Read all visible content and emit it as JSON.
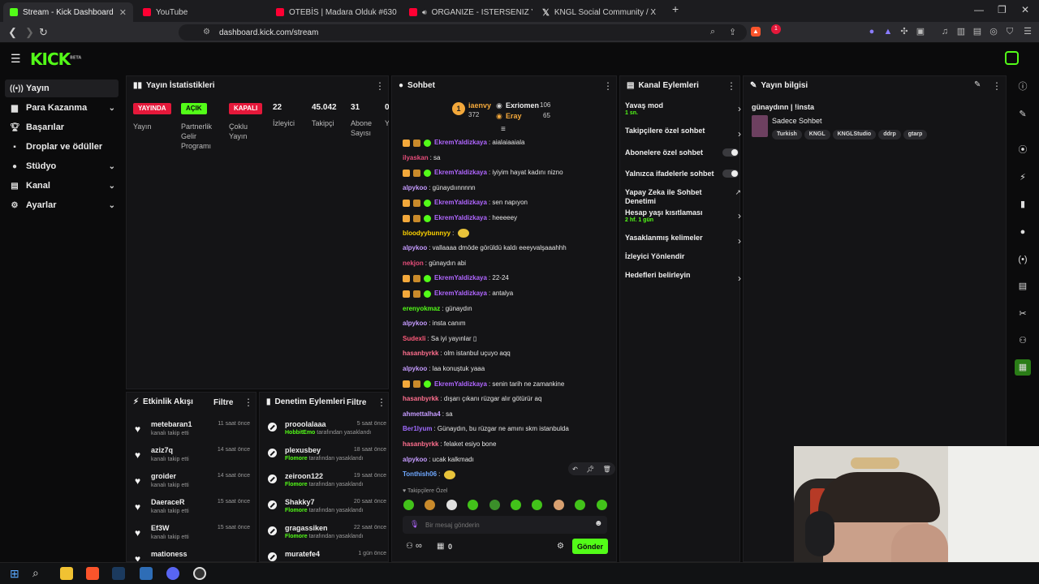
{
  "browser": {
    "tabs": [
      {
        "title": "Stream - Kick Dashboard",
        "fav": "#53fc18"
      },
      {
        "title": "YouTube",
        "fav": "#ff0033"
      },
      {
        "title": "OTEBİS | Madara Olduk #630 - YouTu",
        "fav": "#ff0033"
      },
      {
        "title": "ORGANIZE - ISTERSENIZ YANLIŞ",
        "fav": "#ff0033"
      },
      {
        "title": "KNGL Social Community / X",
        "fav": "#ffffff"
      }
    ],
    "url": "dashboard.kick.com/stream",
    "new_tab": "+",
    "ext_badge": "1"
  },
  "kick": {
    "logo": "KICK",
    "logo_sup": "BETA"
  },
  "sidebar": {
    "items": [
      {
        "label": "Yayın",
        "icon": "broadcast-icon"
      },
      {
        "label": "Para Kazanma",
        "icon": "money-icon",
        "chev": "⌄"
      },
      {
        "label": "Başarılar",
        "icon": "trophy-icon"
      },
      {
        "label": "Droplar ve ödüller",
        "icon": "gift-icon"
      },
      {
        "label": "Stüdyo",
        "icon": "studio-icon",
        "chev": "⌄"
      },
      {
        "label": "Kanal",
        "icon": "channel-icon",
        "chev": "⌄"
      },
      {
        "label": "Ayarlar",
        "icon": "gear-icon",
        "chev": "⌄"
      }
    ]
  },
  "stats": {
    "title": "Yayın İstatistikleri",
    "badges": [
      {
        "text": "YAYINDA",
        "label": "Yayın",
        "bg": "#e5183a",
        "fg": "#ffffff"
      },
      {
        "text": "AÇIK",
        "label": "Partnerlik Gelir Programı",
        "bg": "#53fc18",
        "fg": "#0b0b0c"
      },
      {
        "text": "KAPALI",
        "label": "Çoklu Yayın",
        "bg": "#e5183a",
        "fg": "#ffffff"
      }
    ],
    "numbers": [
      {
        "value": "22",
        "label": "İzleyici"
      },
      {
        "value": "45.042",
        "label": "Takipçi"
      },
      {
        "value": "31",
        "label": "Abone Sayısı"
      },
      {
        "value": "0",
        "label": "Y"
      }
    ]
  },
  "activity": {
    "title": "Etkinlik Akışı",
    "filter": "Filtre",
    "items": [
      {
        "name": "metebaran1",
        "sub": "kanalı takip etti",
        "time": "11 saat önce"
      },
      {
        "name": "aziz7q",
        "sub": "kanalı takip etti",
        "time": "14 saat önce"
      },
      {
        "name": "groider",
        "sub": "kanalı takip etti",
        "time": "14 saat önce"
      },
      {
        "name": "DaeraceR",
        "sub": "kanalı takip etti",
        "time": "15 saat önce"
      },
      {
        "name": "Ef3W",
        "sub": "kanalı takip etti",
        "time": "15 saat önce"
      },
      {
        "name": "mationess",
        "sub": "",
        "time": ""
      }
    ]
  },
  "moderation": {
    "title": "Denetim Eylemleri",
    "filter": "Filtre",
    "items": [
      {
        "name": "prooolalaaa",
        "by": "HobbitEmo",
        "rest": " tarafından yasaklandı",
        "time": "5 saat önce"
      },
      {
        "name": "plexusbey",
        "by": "Flomore",
        "rest": " tarafından yasaklandı",
        "time": "18 saat önce"
      },
      {
        "name": "zeiroon122",
        "by": "Flomore",
        "rest": " tarafından yasaklandı",
        "time": "19 saat önce"
      },
      {
        "name": "Shakky7",
        "by": "Flomore",
        "rest": " tarafından yasaklandı",
        "time": "20 saat önce"
      },
      {
        "name": "gragassiken",
        "by": "Flomore",
        "rest": " tarafından yasaklandı",
        "time": "22 saat önce"
      },
      {
        "name": "muratefe4",
        "by": "",
        "rest": "",
        "time": "1 gün önce"
      }
    ]
  },
  "chat": {
    "title": "Sohbet",
    "leaders": [
      {
        "name": "iaenvy",
        "count": "372"
      },
      {
        "name": "Exriomen",
        "count": "106"
      },
      {
        "name": "Eray",
        "count": "65"
      }
    ],
    "messages": [
      {
        "user": "EkremYaldizkaya",
        "color": "#b066ff",
        "badges": true,
        "text": ": aialaiaaiala"
      },
      {
        "user": "ilyaskan",
        "color": "#e64d7a",
        "badges": false,
        "text": ": sa"
      },
      {
        "user": "EkremYaldizkaya",
        "color": "#b066ff",
        "badges": true,
        "text": ": iyiyim hayat kadını nizno"
      },
      {
        "user": "alpykoo",
        "color": "#c59bff",
        "badges": false,
        "text": ": günaydıınnnnn"
      },
      {
        "user": "EkremYaldizkaya",
        "color": "#b066ff",
        "badges": true,
        "text": ": sen napıyon"
      },
      {
        "user": "EkremYaldizkaya",
        "color": "#b066ff",
        "badges": true,
        "text": ": heeeeey"
      },
      {
        "user": "bloodyybunnyy",
        "color": "#ffd400",
        "badges": false,
        "text": ": "
      },
      {
        "user": "alpykoo",
        "color": "#c59bff",
        "badges": false,
        "text": ": vallaaaa dmöde görüldü kaldı eeeyvalşaaahhh"
      },
      {
        "user": "nekjon",
        "color": "#e64d7a",
        "badges": false,
        "text": ": günaydın abi"
      },
      {
        "user": "EkremYaldizkaya",
        "color": "#b066ff",
        "badges": true,
        "text": ": 22-24"
      },
      {
        "user": "EkremYaldizkaya",
        "color": "#b066ff",
        "badges": true,
        "text": ": antalya"
      },
      {
        "user": "erenyokmaz",
        "color": "#53fc18",
        "badges": false,
        "text": ": günaydın"
      },
      {
        "user": "alpykoo",
        "color": "#c59bff",
        "badges": false,
        "text": ": insta canım"
      },
      {
        "user": "Sudexli",
        "color": "#ff5a7a",
        "badges": false,
        "text": ": Sa iyi yayınlar ▯"
      },
      {
        "user": "hasanbyrkk",
        "color": "#ff6f8e",
        "badges": false,
        "text": ": olm istanbul uçuyo aqq"
      },
      {
        "user": "alpykoo",
        "color": "#c59bff",
        "badges": false,
        "text": ": laa konuştuk yaaa"
      },
      {
        "user": "EkremYaldizkaya",
        "color": "#b066ff",
        "badges": true,
        "text": ": senin tarih ne zamankine"
      },
      {
        "user": "hasanbyrkk",
        "color": "#ff6f8e",
        "badges": false,
        "text": ": dışarı çıkanı rüzgar alır götürür aq"
      },
      {
        "user": "ahmettalha4",
        "color": "#c59bff",
        "badges": false,
        "text": ": sa"
      },
      {
        "user": "Ber1lyum",
        "color": "#a06bff",
        "badges": false,
        "text": ": Günaydın, bu rüzgar ne amını skm istanbulda"
      },
      {
        "user": "hasanbyrkk",
        "color": "#ff6f8e",
        "badges": false,
        "text": ": felaket esiyo bone"
      },
      {
        "user": "alpykoo",
        "color": "#c59bff",
        "badges": false,
        "text": ": ucak kalkmadı"
      },
      {
        "user": "Tonthish06",
        "color": "#6fa8ff",
        "badges": false,
        "text": ": "
      }
    ],
    "followers_only": "Takipçilere Özel",
    "placeholder": "Bir mesaj gönderin",
    "infinite": "∞",
    "count": "0",
    "send": "Gönder"
  },
  "channel_actions": {
    "title": "Kanal Eylemleri",
    "items": [
      {
        "label": "Yavaş mod",
        "sub": "1 sn.",
        "control": "arrow"
      },
      {
        "label": "Takipçilere özel sohbet",
        "sub": "",
        "control": "arrow"
      },
      {
        "label": "Abonelere özel sohbet",
        "sub": "",
        "control": "toggle"
      },
      {
        "label": "Yalnızca ifadelerle sohbet",
        "sub": "",
        "control": "toggle"
      },
      {
        "label": "Yapay Zeka ile Sohbet Denetimi",
        "sub": "",
        "control": "external"
      },
      {
        "label": "Hesap yaşı kısıtlaması",
        "sub": "2 hf. 1 gün",
        "control": "arrow"
      },
      {
        "label": "Yasaklanmış kelimeler",
        "sub": "",
        "control": "arrow"
      },
      {
        "label": "İzleyici Yönlendir",
        "sub": "",
        "control": "none"
      },
      {
        "label": "Hedefleri belirleyin",
        "sub": "",
        "control": "arrow"
      }
    ]
  },
  "stream_info": {
    "title": "Yayın bilgisi",
    "stream_title": "günaydınn | !insta",
    "category": "Sadece Sohbet",
    "tags": [
      "Turkish",
      "KNGL",
      "KNGLStudio",
      "ddrp",
      "gtarp"
    ]
  }
}
